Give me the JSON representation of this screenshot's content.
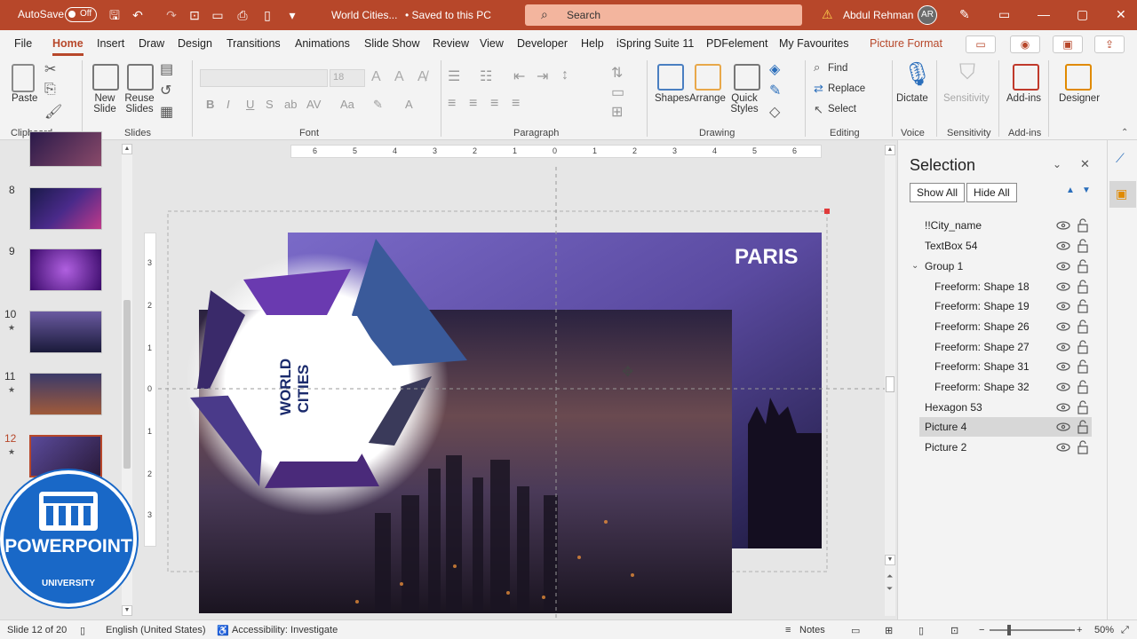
{
  "titlebar": {
    "autosave_label": "AutoSave",
    "autosave_state": "Off",
    "doc_title": "World Cities...",
    "saved_status": "• Saved to this PC",
    "search_placeholder": "Search",
    "user_name": "Abdul Rehman",
    "user_initials": "AR"
  },
  "menu": {
    "items": [
      "File",
      "Home",
      "Insert",
      "Draw",
      "Design",
      "Transitions",
      "Animations",
      "Slide Show",
      "Review",
      "View",
      "Developer",
      "Help",
      "iSpring Suite 11",
      "PDFelement",
      "My Favourites",
      "Picture Format"
    ],
    "active": "Home"
  },
  "ribbon": {
    "clipboard": {
      "paste": "Paste",
      "label": "Clipboard"
    },
    "slides": {
      "new_slide": "New Slide",
      "reuse_slides": "Reuse Slides",
      "label": "Slides"
    },
    "font": {
      "label": "Font",
      "size": "18"
    },
    "paragraph": {
      "label": "Paragraph"
    },
    "drawing": {
      "shapes": "Shapes",
      "arrange": "Arrange",
      "quick_styles": "Quick Styles",
      "label": "Drawing"
    },
    "editing": {
      "find": "Find",
      "replace": "Replace",
      "select": "Select",
      "label": "Editing"
    },
    "voice": {
      "dictate": "Dictate",
      "label": "Voice"
    },
    "sensitivity": {
      "button": "Sensitivity",
      "label": "Sensitivity"
    },
    "addins": {
      "button": "Add-ins",
      "label": "Add-ins"
    },
    "designer": {
      "button": "Designer"
    }
  },
  "thumbnails": [
    {
      "num": "8",
      "star": false
    },
    {
      "num": "9",
      "star": false
    },
    {
      "num": "10",
      "star": true
    },
    {
      "num": "11",
      "star": true
    },
    {
      "num": "12",
      "star": true
    }
  ],
  "slide": {
    "city_label": "PARIS",
    "hexagon_text": "WORLD CITIES"
  },
  "ruler": {
    "h_ticks": [
      "6",
      "5",
      "4",
      "3",
      "2",
      "1",
      "0",
      "1",
      "2",
      "3",
      "4",
      "5",
      "6"
    ],
    "v_ticks": [
      "3",
      "2",
      "1",
      "0",
      "1",
      "2",
      "3"
    ]
  },
  "selection_pane": {
    "title": "Selection",
    "show_all": "Show All",
    "hide_all": "Hide All",
    "items": [
      {
        "name": "!!City_name",
        "indent": 0,
        "selected": false
      },
      {
        "name": "TextBox 54",
        "indent": 0,
        "selected": false
      },
      {
        "name": "Group 1",
        "indent": 0,
        "selected": false,
        "expander": true
      },
      {
        "name": "Freeform: Shape 18",
        "indent": 1,
        "selected": false
      },
      {
        "name": "Freeform: Shape 19",
        "indent": 1,
        "selected": false
      },
      {
        "name": "Freeform: Shape 26",
        "indent": 1,
        "selected": false
      },
      {
        "name": "Freeform: Shape 27",
        "indent": 1,
        "selected": false
      },
      {
        "name": "Freeform: Shape 31",
        "indent": 1,
        "selected": false
      },
      {
        "name": "Freeform: Shape 32",
        "indent": 1,
        "selected": false
      },
      {
        "name": "Hexagon 53",
        "indent": 0,
        "selected": false
      },
      {
        "name": "Picture 4",
        "indent": 0,
        "selected": true
      },
      {
        "name": "Picture 2",
        "indent": 0,
        "selected": false
      }
    ]
  },
  "status": {
    "slide_info": "Slide 12 of 20",
    "language": "English (United States)",
    "accessibility": "Accessibility: Investigate",
    "notes": "Notes",
    "zoom": "50%"
  },
  "logo": {
    "line1": "POWERPOINT",
    "line2": "UNIVERSITY"
  },
  "colors": {
    "accent": "#b7472a",
    "search_bg": "#f3b59e",
    "logo_blue": "#1968c7",
    "hexagon_text": "#1a2a6c"
  }
}
